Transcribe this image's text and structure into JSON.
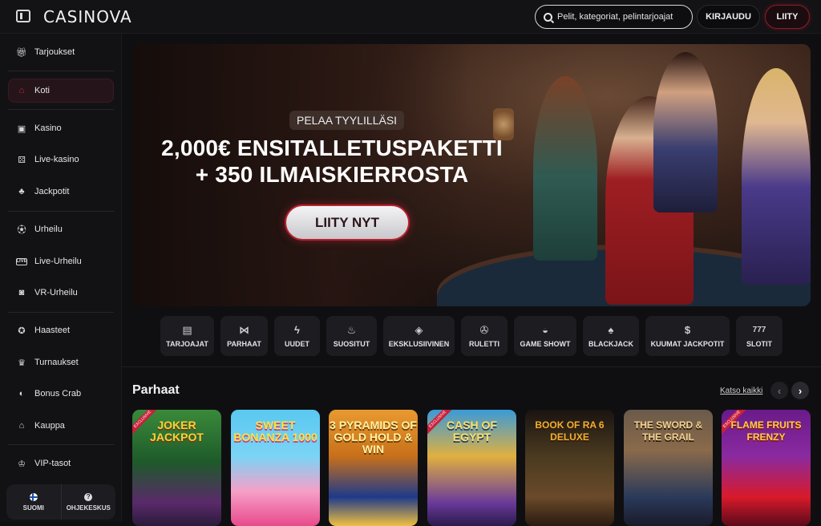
{
  "header": {
    "logo": "CASINOVA",
    "search_placeholder": "Pelit, kategoriat, pelintarjoajat",
    "login_label": "KIRJAUDU",
    "join_label": "LIITY"
  },
  "sidebar": {
    "items": [
      {
        "label": "Tarjoukset",
        "icon": "gift-icon"
      },
      {
        "label": "Koti",
        "icon": "home-icon",
        "active": true
      },
      {
        "label": "Kasino",
        "icon": "slot-machine-icon"
      },
      {
        "label": "Live-kasino",
        "icon": "dice-icon"
      },
      {
        "label": "Jackpotit",
        "icon": "clover-icon"
      },
      {
        "label": "Urheilu",
        "icon": "football-icon"
      },
      {
        "label": "Live-Urheilu",
        "icon": "live-icon"
      },
      {
        "label": "VR-Urheilu",
        "icon": "vr-icon"
      },
      {
        "label": "Haasteet",
        "icon": "medal-icon"
      },
      {
        "label": "Turnaukset",
        "icon": "trophy-icon"
      },
      {
        "label": "Bonus Crab",
        "icon": "crab-icon"
      },
      {
        "label": "Kauppa",
        "icon": "shop-icon"
      },
      {
        "label": "VIP-tasot",
        "icon": "crown-icon"
      }
    ],
    "language_label": "SUOMI",
    "help_label": "OHJEKESKUS"
  },
  "banner": {
    "eyebrow": "PELAA TYYLILLÄSI",
    "headline_line1": "2,000€ ENSITALLETUSPAKETTI",
    "headline_line2": "+ 350 ILMAISKIERROSTA",
    "cta_label": "LIITY NYT"
  },
  "categories": [
    {
      "label": "TARJOAJAT",
      "icon": "card-icon"
    },
    {
      "label": "PARHAAT",
      "icon": "bowtie-icon"
    },
    {
      "label": "UUDET",
      "icon": "lightning-icon"
    },
    {
      "label": "SUOSITUT",
      "icon": "flame-icon"
    },
    {
      "label": "EKSKLUSIIVINEN",
      "icon": "diamond-icon"
    },
    {
      "label": "RULETTI",
      "icon": "roulette-icon"
    },
    {
      "label": "GAME SHOWT",
      "icon": "mask-icon"
    },
    {
      "label": "BLACKJACK",
      "icon": "cards-icon"
    },
    {
      "label": "KUUMAT JACKPOTIT",
      "icon": "hot-money-icon"
    },
    {
      "label": "SLOTIT",
      "icon": "777-icon"
    }
  ],
  "section": {
    "title": "Parhaat",
    "see_all_label": "Katso kaikki"
  },
  "games": [
    {
      "title": "JOKER JACKPOT",
      "badge": "EXCLUSIVE"
    },
    {
      "title": "SWEET BONANZA 1000",
      "badge": ""
    },
    {
      "title": "3 PYRAMIDS OF GOLD HOLD & WIN",
      "badge": ""
    },
    {
      "title": "CASH OF EGYPT",
      "badge": "EXCLUSIVE"
    },
    {
      "title": "BOOK OF RA 6 DELUXE",
      "badge": ""
    },
    {
      "title": "THE SWORD & THE GRAIL",
      "badge": ""
    },
    {
      "title": "FLAME FRUITS FRENZY",
      "badge": "EXCLUSIVE"
    }
  ],
  "colors": {
    "accent": "#c8203a",
    "background": "#0f0f12",
    "sidebar": "#121215"
  }
}
